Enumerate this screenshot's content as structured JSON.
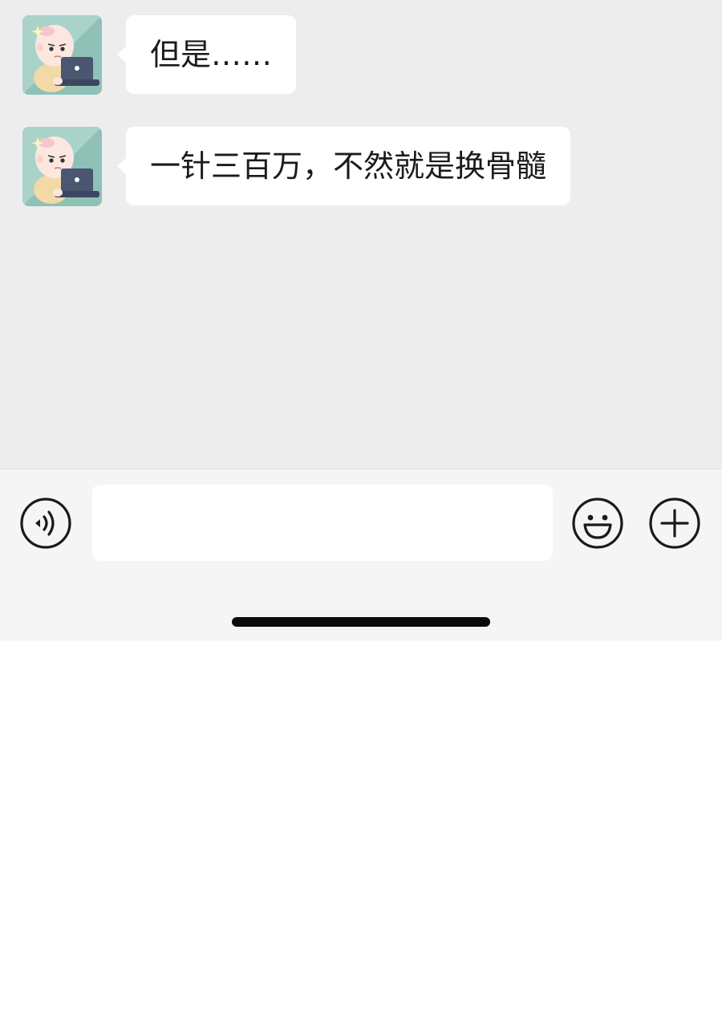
{
  "messages": [
    {
      "sender_avatar": "baby-with-laptop-avatar",
      "text": "但是……"
    },
    {
      "sender_avatar": "baby-with-laptop-avatar",
      "text": "一针三百万，不然就是换骨髓"
    }
  ],
  "input_bar": {
    "voice_icon": "voice-icon",
    "text_value": "",
    "emoji_icon": "emoji-icon",
    "plus_icon": "plus-icon"
  },
  "colors": {
    "chat_background": "#ededed",
    "bubble": "#ffffff",
    "input_bar_background": "#f5f5f5",
    "text": "#1b1b1b"
  }
}
